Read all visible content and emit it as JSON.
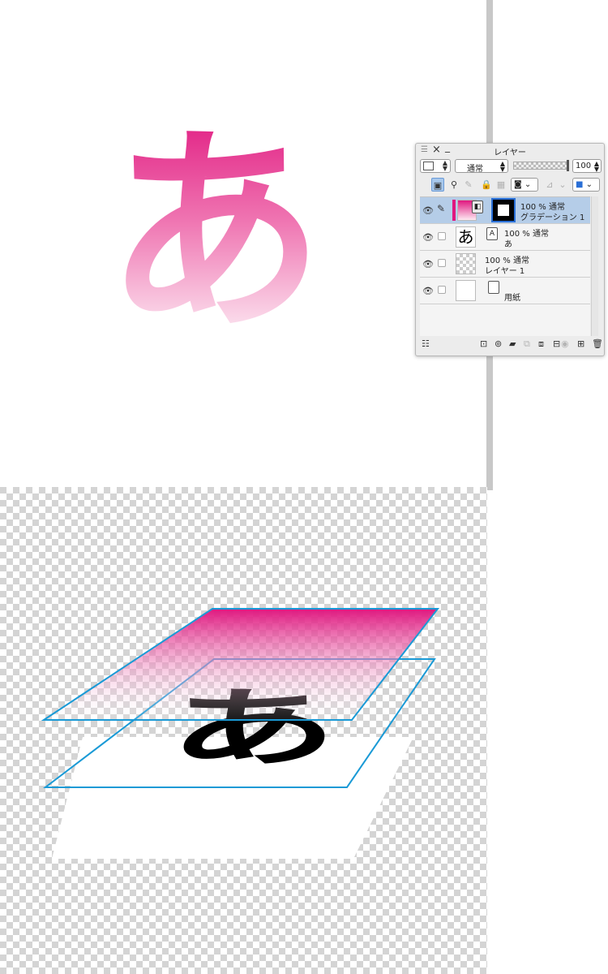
{
  "canvas_glyph": "あ",
  "colors": {
    "magenta": "#e0177f",
    "pink_light": "#fde9f2",
    "selection_blue": "#b5cde8",
    "frame_blue": "#1a9ad6"
  },
  "panel": {
    "title": "レイヤー",
    "blend_mode": "通常",
    "opacity": "100",
    "icons": {
      "menu": "menu-icon",
      "close": "close-icon",
      "minimize": "minimize-icon"
    }
  },
  "layers": [
    {
      "mode": "100 % 通常",
      "name": "グラデーション 1",
      "type": "gradient",
      "selected": true
    },
    {
      "mode": "100 % 通常",
      "name": "あ",
      "type": "text",
      "thumb_text": "あ",
      "selected": false
    },
    {
      "mode": "100 % 通常",
      "name": "レイヤー 1",
      "type": "raster",
      "selected": false
    },
    {
      "mode": "",
      "name": "用紙",
      "type": "paper",
      "selected": false
    }
  ],
  "illustration_glyph": "あ"
}
